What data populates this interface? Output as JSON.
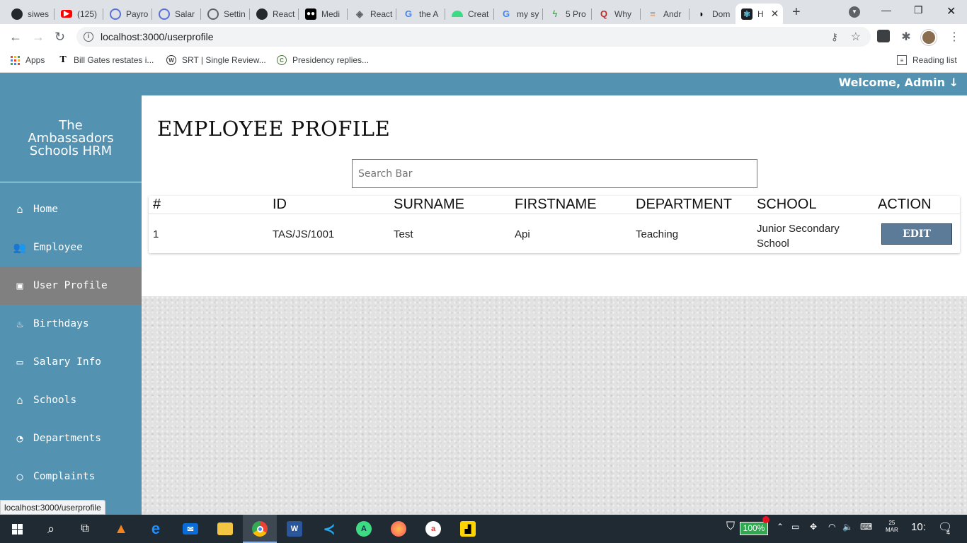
{
  "browser": {
    "tabs": [
      {
        "label": "siwes",
        "icon": "github-icon",
        "color": "#24292e"
      },
      {
        "label": "(125)",
        "icon": "youtube-icon",
        "color": "#ff0000"
      },
      {
        "label": "Payro",
        "icon": "globe-icon",
        "color": "#5b6fd6"
      },
      {
        "label": "Salar",
        "icon": "globe-icon",
        "color": "#5b6fd6"
      },
      {
        "label": "Settin",
        "icon": "settings-site-icon",
        "color": "#5f6368"
      },
      {
        "label": "React",
        "icon": "github-icon",
        "color": "#24292e"
      },
      {
        "label": "Medi",
        "icon": "medium-icon",
        "color": "#000000"
      },
      {
        "label": "React",
        "icon": "diamond-icon",
        "color": "#5f6368"
      },
      {
        "label": "the A",
        "icon": "google-icon",
        "color": "#4285f4"
      },
      {
        "label": "Creat",
        "icon": "android-icon",
        "color": "#3ddc84"
      },
      {
        "label": "my sy",
        "icon": "google-icon",
        "color": "#4285f4"
      },
      {
        "label": "5 Pro",
        "icon": "bitbucket-icon",
        "color": "#4caf50"
      },
      {
        "label": "Why",
        "icon": "quora-icon",
        "color": "#b92b27"
      },
      {
        "label": "Andr",
        "icon": "stackoverflow-icon",
        "color": "#f48024"
      },
      {
        "label": "Dom",
        "icon": "medium-icon",
        "color": "#000000"
      },
      {
        "label": "H",
        "icon": "react-icon",
        "color": "#1b1f24",
        "active": true
      }
    ],
    "url": "localhost:3000/userprofile",
    "bookmarks": [
      {
        "label": "Apps",
        "icon": "apps-grid-icon"
      },
      {
        "label": "Bill Gates restates i...",
        "icon": "news-icon"
      },
      {
        "label": "SRT | Single Review...",
        "icon": "wordpress-icon"
      },
      {
        "label": "Presidency replies...",
        "icon": "site-icon"
      }
    ],
    "reading_list": "Reading list",
    "status_url": "localhost:3000/userprofile"
  },
  "app": {
    "welcome": "Welcome, Admin",
    "brand_lines": [
      "The",
      "Ambassadors",
      "Schools HRM"
    ],
    "nav": [
      {
        "label": "Home",
        "icon": "home-icon",
        "glyph": "⌂"
      },
      {
        "label": "Employee",
        "icon": "users-icon",
        "glyph": "👥"
      },
      {
        "label": "User Profile",
        "icon": "briefcase-icon",
        "glyph": "▣",
        "active": true
      },
      {
        "label": "Birthdays",
        "icon": "birthday-cake-icon",
        "glyph": "♨"
      },
      {
        "label": "Salary Info",
        "icon": "money-bill-icon",
        "glyph": "▭"
      },
      {
        "label": "Schools",
        "icon": "school-icon",
        "glyph": "⌂"
      },
      {
        "label": "Departments",
        "icon": "gauge-icon",
        "glyph": "◔"
      },
      {
        "label": "Complaints",
        "icon": "comment-icon",
        "glyph": "○"
      }
    ],
    "page_title": "EMPLOYEE PROFILE",
    "search_placeholder": "Search Bar",
    "table": {
      "columns": [
        "#",
        "ID",
        "SURNAME",
        "FIRSTNAME",
        "DEPARTMENT",
        "SCHOOL",
        "ACTION"
      ],
      "rows": [
        {
          "num": "1",
          "id": "TAS/JS/1001",
          "surname": "Test",
          "firstname": "Api",
          "department": "Teaching",
          "school_line1": "Junior Secondary",
          "school_line2": "School",
          "action": "EDIT"
        }
      ]
    }
  },
  "taskbar": {
    "battery": "100%",
    "date_day": "25",
    "date_month": "MAR",
    "time": "10:",
    "notifications": "4"
  },
  "colors": {
    "app_blue": "#5492b2",
    "active_nav": "#808080",
    "edit_button": "#5b7b99"
  }
}
